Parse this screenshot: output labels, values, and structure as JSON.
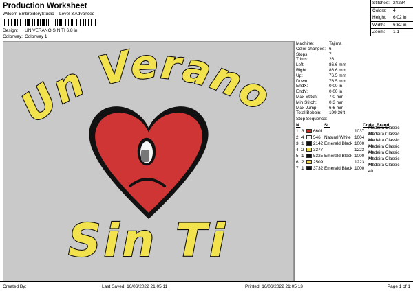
{
  "header": {
    "title": "Production Worksheet",
    "subtitle": "Wilcom EmbroideryStudio – Level 3 Advanced",
    "barcode_suffix": ","
  },
  "design": {
    "design_label": "Design:",
    "design_value": "UN VERANO SIN TI 6,8 in",
    "colorway_label": "Colorway:",
    "colorway_value": "Colorway 1"
  },
  "stats": [
    {
      "label": "Stitches:",
      "value": "24234"
    },
    {
      "label": "Colors:",
      "value": "4"
    },
    {
      "label": "Height:",
      "value": "6.02 in"
    },
    {
      "label": "Width:",
      "value": "6.82 in"
    },
    {
      "label": "Zoom:",
      "value": "1:1"
    }
  ],
  "artwork": {
    "line1": "Un Verano",
    "line2": "Sin Ti"
  },
  "machine_info": [
    {
      "label": "Machine:",
      "value": "Tajima"
    },
    {
      "label": "Color changes:",
      "value": "6"
    },
    {
      "label": "Stops:",
      "value": "7"
    },
    {
      "label": "Trims:",
      "value": "26"
    },
    {
      "label": "Left:",
      "value": "86.6 mm"
    },
    {
      "label": "Right:",
      "value": "86.6 mm"
    },
    {
      "label": "Up:",
      "value": "76.5 mm"
    },
    {
      "label": "Down:",
      "value": "76.5 mm"
    },
    {
      "label": "EndX:",
      "value": "0.00 in"
    },
    {
      "label": "EndY:",
      "value": "0.00 in"
    },
    {
      "label": "Max Stitch:",
      "value": "7.0 mm"
    },
    {
      "label": "Min Stitch:",
      "value": "0.3 mm"
    },
    {
      "label": "Max Jump:",
      "value": "6.6 mm"
    },
    {
      "label": "Total Bobbin:",
      "value": "199.36ft"
    }
  ],
  "stop_sequence": {
    "title": "Stop Sequence:",
    "headers": [
      "N.",
      "St.",
      "Code",
      "Brand"
    ],
    "rows": [
      {
        "n": "1.",
        "idx": "3",
        "st": "6601",
        "name": "",
        "code": "1037",
        "brand": "Madeira Classic 40",
        "color": "#c62828"
      },
      {
        "n": "2.",
        "idx": "4",
        "st": "546",
        "name": "Natural White",
        "code": "1004",
        "brand": "Madeira Classic 40",
        "color": "#f4f4f4"
      },
      {
        "n": "3.",
        "idx": "1",
        "st": "2142",
        "name": "Emerald Black",
        "code": "1000",
        "brand": "Madeira Classic 40",
        "color": "#111111"
      },
      {
        "n": "4.",
        "idx": "2",
        "st": "3377",
        "name": "",
        "code": "1223",
        "brand": "Madeira Classic 40",
        "color": "#f1e04a"
      },
      {
        "n": "5.",
        "idx": "1",
        "st": "5325",
        "name": "Emerald Black",
        "code": "1000",
        "brand": "Madeira Classic 40",
        "color": "#111111"
      },
      {
        "n": "6.",
        "idx": "2",
        "st": "2509",
        "name": "",
        "code": "1223",
        "brand": "Madeira Classic 40",
        "color": "#f1e04a"
      },
      {
        "n": "7.",
        "idx": "1",
        "st": "3732",
        "name": "Emerald Black",
        "code": "1000",
        "brand": "Madeira Classic 40",
        "color": "#111111"
      }
    ]
  },
  "footer": {
    "created": "Created By:",
    "last_saved": "Last Saved: 16/06/2022 21:05:11",
    "printed": "Printed: 16/06/2022 21:05:13",
    "page": "Page 1 of 1"
  }
}
